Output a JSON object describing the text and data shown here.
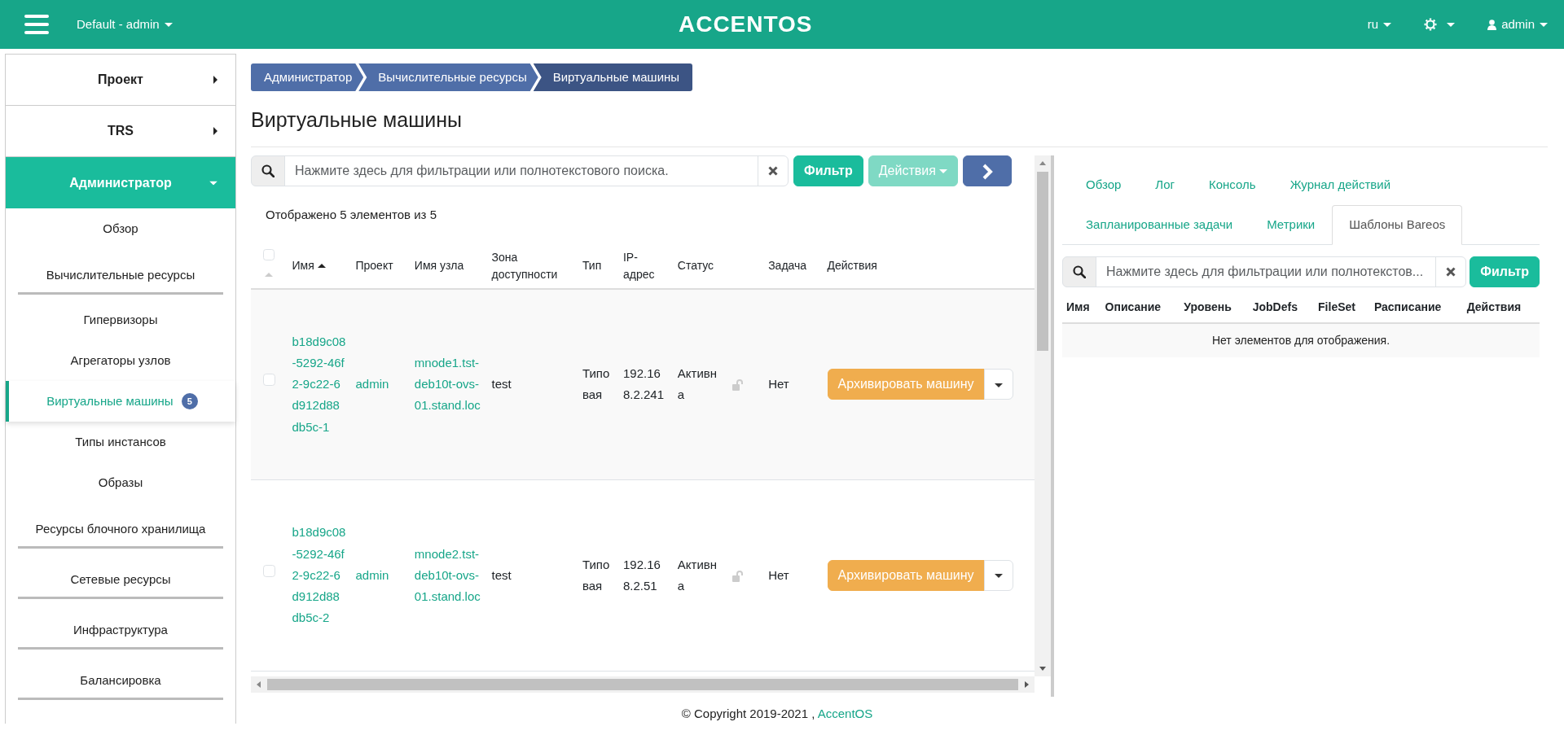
{
  "header": {
    "project_menu": "Default - admin",
    "logo": "ACCENTOS",
    "language": "ru",
    "user": "admin"
  },
  "sidebar": {
    "sections": [
      {
        "label": "Проект",
        "expanded": false
      },
      {
        "label": "TRS",
        "expanded": false
      },
      {
        "label": "Администратор",
        "expanded": true,
        "children": [
          {
            "kind": "link",
            "label": "Обзор",
            "selected": false
          },
          {
            "kind": "group",
            "label": "Вычислительные ресурсы",
            "children": [
              {
                "kind": "link",
                "label": "Гипервизоры",
                "selected": false
              },
              {
                "kind": "link",
                "label": "Агрегаторы узлов",
                "selected": false
              },
              {
                "kind": "link",
                "label": "Виртуальные машины",
                "selected": true,
                "badge": "5"
              },
              {
                "kind": "link",
                "label": "Типы инстансов",
                "selected": false
              },
              {
                "kind": "link",
                "label": "Образы",
                "selected": false
              }
            ]
          },
          {
            "kind": "group",
            "label": "Ресурсы блочного хранилища"
          },
          {
            "kind": "group",
            "label": "Сетевые ресурсы"
          },
          {
            "kind": "group",
            "label": "Инфраструктура"
          },
          {
            "kind": "group",
            "label": "Балансировка"
          }
        ]
      }
    ]
  },
  "breadcrumbs": [
    {
      "label": "Администратор",
      "selected": false
    },
    {
      "label": "Вычислительные ресурсы",
      "selected": false
    },
    {
      "label": "Виртуальные машины",
      "selected": true
    }
  ],
  "page_title": "Виртуальные машины",
  "instances": {
    "search": {
      "placeholder": "Нажмите здесь для фильтрации или полнотекстового поиска."
    },
    "filter_button": "Фильтр",
    "actions_button": {
      "label": "Действия",
      "disabled": true
    },
    "count_text": "Отображено 5 элементов из 5",
    "select_all": {
      "checked": false
    },
    "columns": [
      {
        "label": "Имя",
        "sorted": true
      },
      {
        "label": "Проект"
      },
      {
        "label": "Имя узла"
      },
      {
        "label": "Зона доступности"
      },
      {
        "label": "Тип"
      },
      {
        "label": "IP-адрес"
      },
      {
        "label": "Статус"
      },
      {
        "label": "Задача"
      },
      {
        "label": "Действия"
      }
    ],
    "rows": [
      {
        "selected": false,
        "name": "b18d9c08-5292-46f2-9c22-6d912d88db5c-1",
        "project": "admin",
        "host": "mnode1.tst-deb10t-ovs-01.stand.loc",
        "zone": "test",
        "type": "Типовая",
        "ip": "192.168.2.241",
        "status": "Активна",
        "locked": false,
        "task": "Нет",
        "action": "Архивировать машину"
      },
      {
        "selected": false,
        "name": "b18d9c08-5292-46f2-9c22-6d912d88db5c-2",
        "project": "admin",
        "host": "mnode2.tst-deb10t-ovs-01.stand.loc",
        "zone": "test",
        "type": "Типовая",
        "ip": "192.168.2.51",
        "status": "Активна",
        "locked": false,
        "task": "Нет",
        "action": "Архивировать машину"
      }
    ]
  },
  "detail": {
    "tabs": [
      {
        "label": "Обзор",
        "selected": false
      },
      {
        "label": "Лог",
        "selected": false
      },
      {
        "label": "Консоль",
        "selected": false
      },
      {
        "label": "Журнал действий",
        "selected": false
      },
      {
        "label": "Запланированные задачи",
        "selected": false
      },
      {
        "label": "Метрики",
        "selected": false
      },
      {
        "label": "Шаблоны Bareos",
        "selected": true
      }
    ],
    "search": {
      "placeholder": "Нажмите здесь для фильтрации или полнотекстов..."
    },
    "filter_button": "Фильтр",
    "columns": [
      "Имя",
      "Описание",
      "Уровень",
      "JobDefs",
      "FileSet",
      "Расписание",
      "Действия"
    ],
    "empty_text": "Нет элементов для отображения."
  },
  "footer": {
    "text": "© Copyright 2019-2021 , ",
    "link": "AccentOS"
  }
}
